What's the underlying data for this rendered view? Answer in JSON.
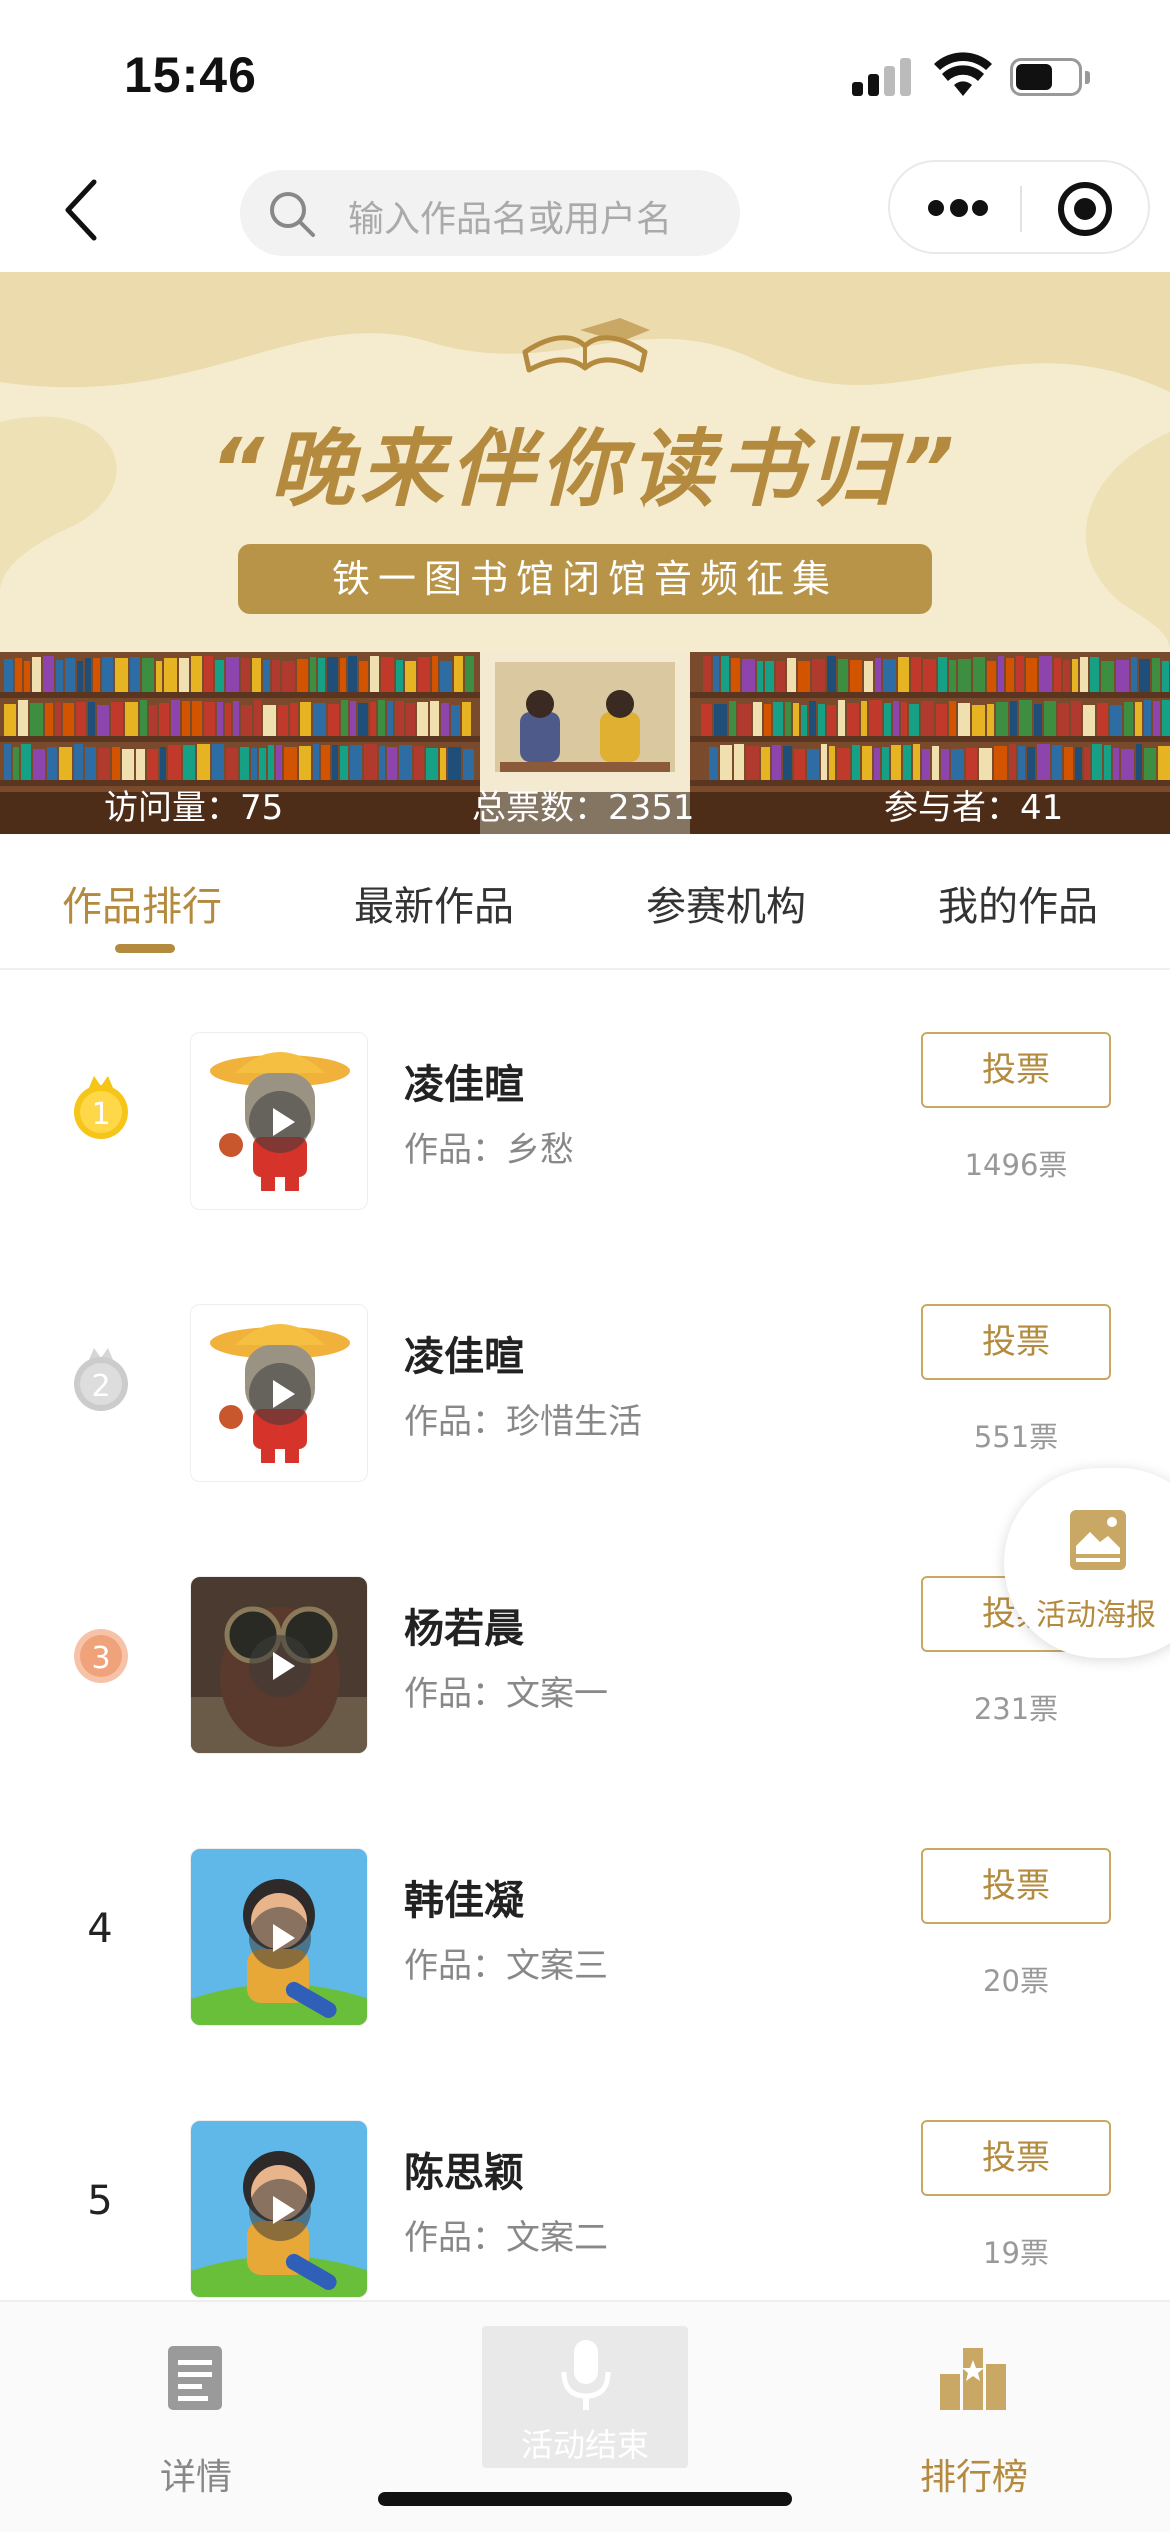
{
  "status_bar": {
    "time": "15:46",
    "battery_level": 0.6
  },
  "nav": {
    "search_placeholder": "输入作品名或用户名"
  },
  "banner": {
    "title": "“晚来伴你读书归”",
    "subtitle": "铁一图书馆闭馆音频征集",
    "stats": {
      "visits": "访问量：75",
      "total_votes": "总票数：2351",
      "participants": "参与者：41"
    }
  },
  "tabs": [
    {
      "label": "作品排行",
      "active": true
    },
    {
      "label": "最新作品",
      "active": false
    },
    {
      "label": "参赛机构",
      "active": false
    },
    {
      "label": "我的作品",
      "active": false
    }
  ],
  "entries": [
    {
      "rank": "1",
      "name": "凌佳暄",
      "work": "作品：乡愁",
      "vote_label": "投票",
      "votes": "1496票"
    },
    {
      "rank": "2",
      "name": "凌佳暄",
      "work": "作品：珍惜生活",
      "vote_label": "投票",
      "votes": "551票"
    },
    {
      "rank": "3",
      "name": "杨若晨",
      "work": "作品：文案一",
      "vote_label": "投票",
      "votes": "231票"
    },
    {
      "rank": "4",
      "name": "韩佳凝",
      "work": "作品：文案三",
      "vote_label": "投票",
      "votes": "20票"
    },
    {
      "rank": "5",
      "name": "陈思颖",
      "work": "作品：文案二",
      "vote_label": "投票",
      "votes": "19票"
    }
  ],
  "floating_button": {
    "label": "活动海报"
  },
  "bottom_bar": {
    "details": "详情",
    "record": "活动结束",
    "ranking": "排行榜"
  },
  "colors": {
    "accent": "#b48a3e",
    "gold": "#f5c518",
    "silver": "#cccccc",
    "bronze": "#f0a27a"
  }
}
